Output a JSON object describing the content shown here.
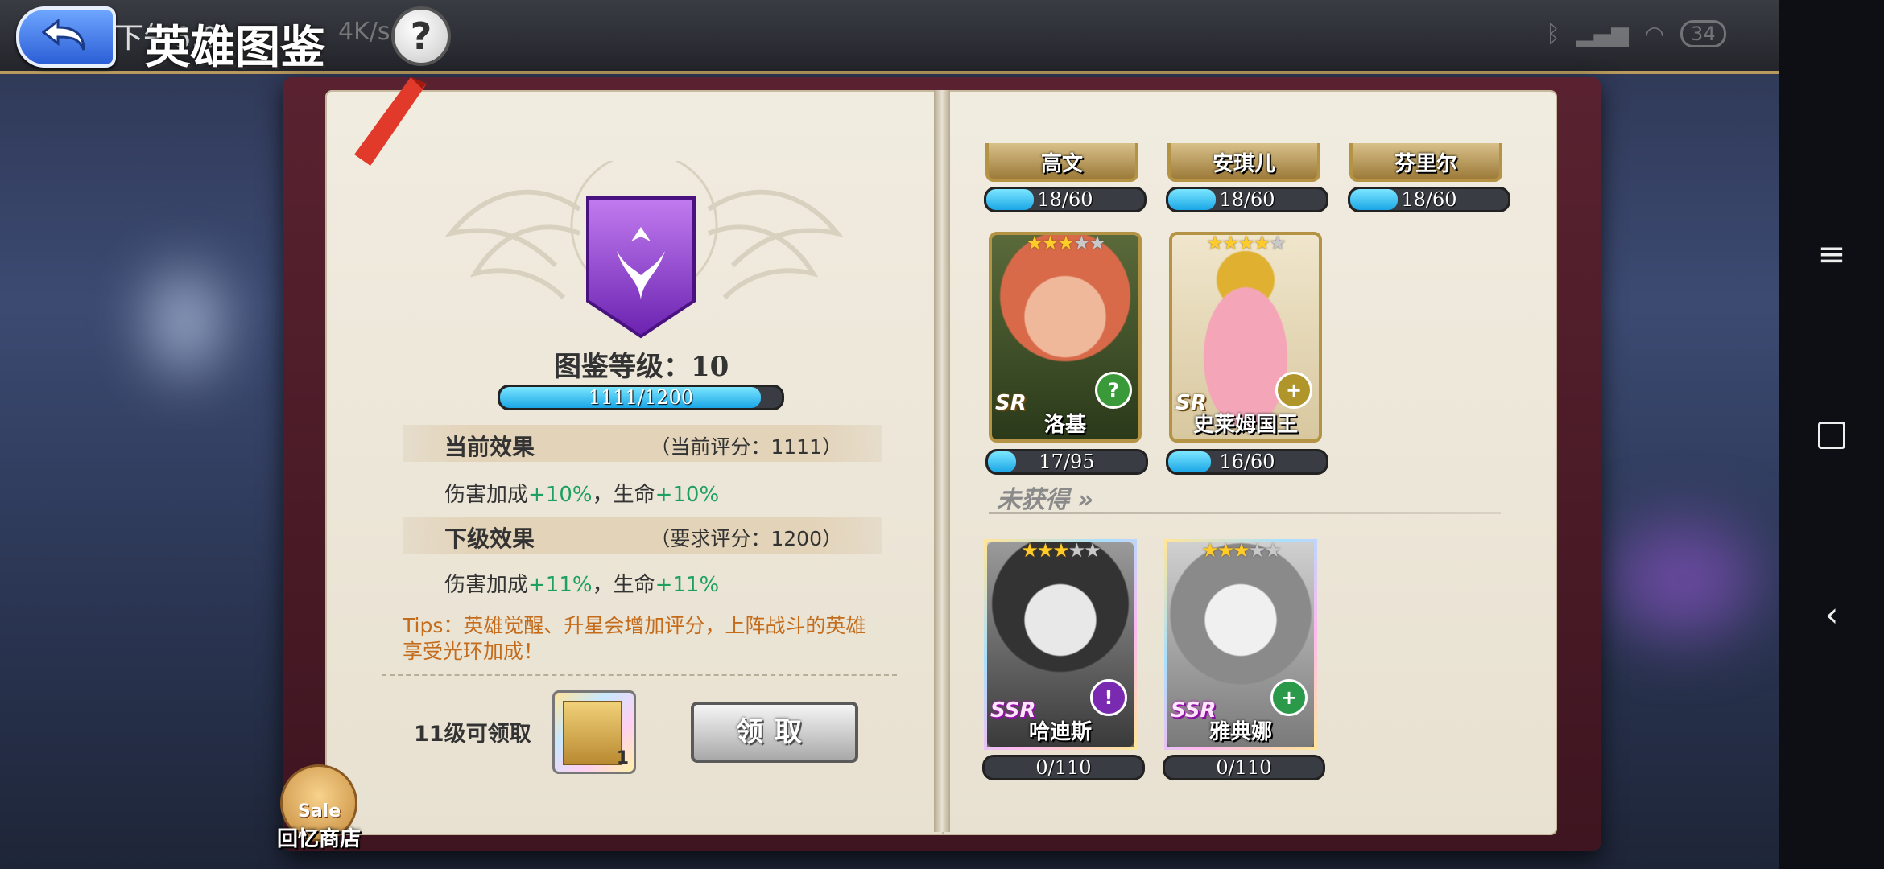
{
  "header": {
    "title": "英雄图鉴",
    "status_text": "下午6:0",
    "speed_text": "4K/s",
    "battery": "34",
    "help_label": "?"
  },
  "left": {
    "level_label": "图鉴等级：10",
    "progress": {
      "text": "1111/1200",
      "current": 1111,
      "max": 1200
    },
    "current_effect": {
      "title": "当前效果",
      "score": "（当前评分：1111）",
      "prefix1": "伤害加成",
      "val1": "+10%",
      "sep": "，生命",
      "val2": "+10%"
    },
    "next_effect": {
      "title": "下级效果",
      "score": "（要求评分：1200）",
      "prefix1": "伤害加成",
      "val1": "+11%",
      "sep": "，生命",
      "val2": "+11%"
    },
    "tips": "Tips：英雄觉醒、升星会增加评分，上阵战斗的英雄享受光环加成！",
    "claim_condition": "11级可领取",
    "reward_count": "1",
    "claim_button": "领取",
    "shop": {
      "sale": "Sale",
      "label": "回忆商店"
    }
  },
  "right": {
    "top_row": [
      {
        "name": "高文",
        "progress": "18/60",
        "fill": 0.3
      },
      {
        "name": "安琪儿",
        "progress": "18/60",
        "fill": 0.3
      },
      {
        "name": "芬里尔",
        "progress": "18/60",
        "fill": 0.3
      }
    ],
    "owned": [
      {
        "name": "洛基",
        "rarity": "SR",
        "stars": 3,
        "badge": "?",
        "badge_color": "#3a9a3a",
        "progress": "17/95",
        "fill": 0.18
      },
      {
        "name": "史莱姆国王",
        "rarity": "SR",
        "stars": 4,
        "badge": "+",
        "badge_color": "#b0962a",
        "progress": "16/60",
        "fill": 0.27
      }
    ],
    "unobtained_label": "未获得",
    "unobtained": [
      {
        "name": "哈迪斯",
        "rarity": "SSR",
        "stars": 3,
        "badge": "!",
        "badge_color": "#7a2ab0",
        "progress": "0/110",
        "fill": 0
      },
      {
        "name": "雅典娜",
        "rarity": "SSR",
        "stars": 3,
        "badge": "+",
        "badge_color": "#2a9a4a",
        "progress": "0/110",
        "fill": 0
      }
    ]
  },
  "colors": {
    "accent_blue": "#1aa6e6",
    "bonus_green": "#1ea060",
    "tips_orange": "#c46c1c",
    "book_red": "#5a2230"
  }
}
